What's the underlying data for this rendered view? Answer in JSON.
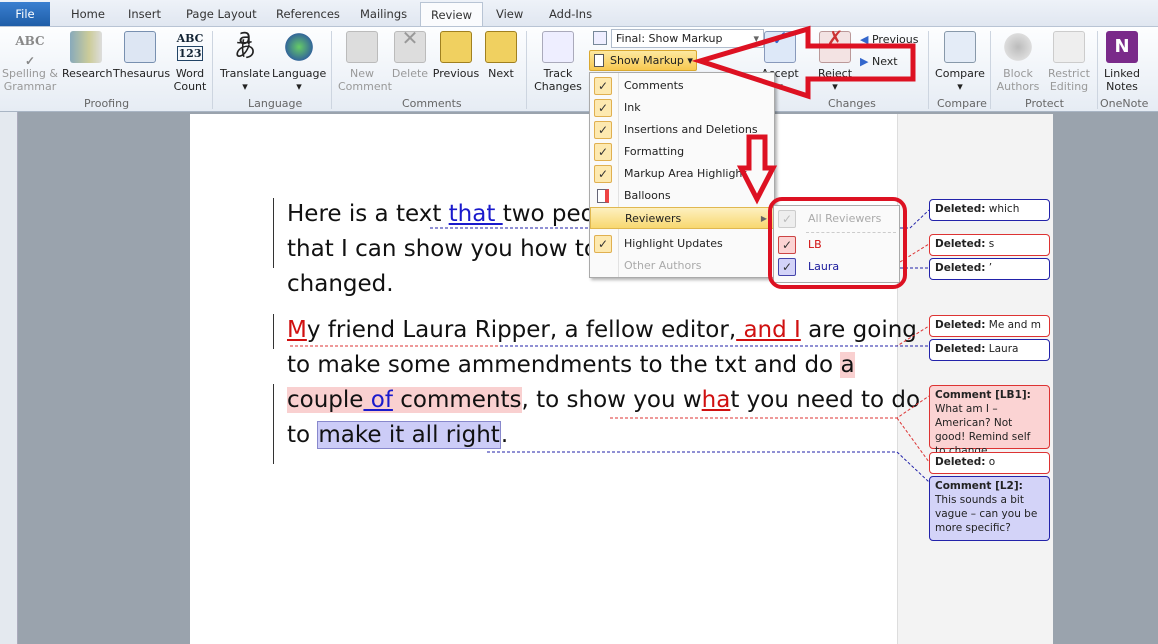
{
  "tabs": {
    "file": "File",
    "items": [
      "Home",
      "Insert",
      "Page Layout",
      "References",
      "Mailings",
      "Review",
      "View",
      "Add-Ins"
    ],
    "active": "Review"
  },
  "ribbon": {
    "proofing": {
      "label": "Proofing",
      "spelling": "Spelling &",
      "spelling2": "Grammar",
      "research": "Research",
      "thesaurus": "Thesaurus",
      "wordcount": "Word",
      "wordcount2": "Count"
    },
    "language": {
      "label": "Language",
      "translate": "Translate",
      "language": "Language"
    },
    "comments": {
      "label": "Comments",
      "new": "New",
      "new2": "Comment",
      "delete": "Delete",
      "previous": "Previous",
      "next": "Next"
    },
    "tracking": {
      "track": "Track",
      "track2": "Changes",
      "display": "Final: Show Markup",
      "show_markup": "Show Markup"
    },
    "changes": {
      "label": "Changes",
      "accept": "Accept",
      "reject": "Reject",
      "previous": "Previous",
      "next": "Next"
    },
    "compare": {
      "label": "Compare",
      "compare": "Compare"
    },
    "protect": {
      "label": "Protect",
      "block": "Block",
      "block2": "Authors",
      "restrict": "Restrict",
      "restrict2": "Editing"
    },
    "onenote": {
      "label": "OneNote",
      "linked": "Linked",
      "linked2": "Notes"
    }
  },
  "menu": {
    "items": [
      {
        "label": "Comments",
        "checked": true
      },
      {
        "label": "Ink",
        "checked": true
      },
      {
        "label": "Insertions and Deletions",
        "checked": true
      },
      {
        "label": "Formatting",
        "checked": true
      },
      {
        "label": "Markup Area Highlight",
        "checked": true
      },
      {
        "label": "Balloons",
        "icon": "balloons-icon"
      },
      {
        "label": "Reviewers",
        "submenu": true
      },
      {
        "label": "Highlight Updates",
        "checked": true
      },
      {
        "label": "Other Authors",
        "disabled": true
      }
    ]
  },
  "submenu": {
    "all": "All Reviewers",
    "reviewers": [
      {
        "name": "LB",
        "color": "#d01010"
      },
      {
        "name": "Laura",
        "color": "#1a1a9c"
      }
    ]
  },
  "document": {
    "l1a": "Here is a text ",
    "l1ins": "that ",
    "l1b": "two peop",
    "l2": "that I can show you how to a",
    "l3": "changed.",
    "l4ins": "M",
    "l4a": "y friend Laura Ripper, a fellow editor,",
    "l4ins2": " and I",
    "l4b": " are going",
    "l5a": "to make some ammendments to the txt and do ",
    "l5hl": "a",
    "l6hl1": "couple",
    "l6ins": " of",
    "l6hl2": " comments",
    "l6a": ", to show you w",
    "l6ins2": "ha",
    "l6b": "t you need to do",
    "l7a": "to ",
    "l7hl": "make it all right",
    "l7b": "."
  },
  "balloons": [
    {
      "kind": "Deleted:",
      "text": "which",
      "author": "Laura"
    },
    {
      "kind": "Deleted:",
      "text": "s",
      "author": "LB"
    },
    {
      "kind": "Deleted:",
      "text": "’",
      "author": "Laura"
    },
    {
      "kind": "Deleted:",
      "text": "Me and m",
      "author": "LB"
    },
    {
      "kind": "Deleted:",
      "text": "Laura",
      "author": "Laura"
    },
    {
      "kind": "Comment [LB1]:",
      "text": "What am I – American? Not good! Remind self to change.",
      "author": "LB"
    },
    {
      "kind": "Deleted:",
      "text": "o",
      "author": "LB"
    },
    {
      "kind": "Comment [L2]:",
      "text": "This sounds a bit vague – can  you be more specific?",
      "author": "Laura"
    }
  ],
  "colors": {
    "lb": "#d01010",
    "laura": "#1a1acc",
    "annotation_red": "#dd1122"
  }
}
